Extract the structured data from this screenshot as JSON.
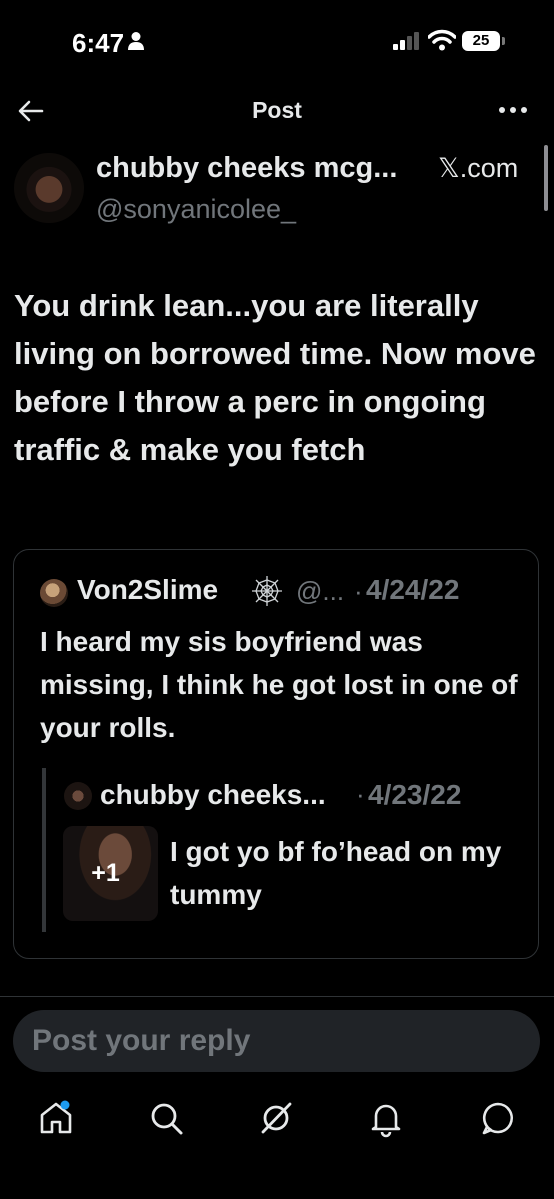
{
  "status_bar": {
    "time": "6:47",
    "battery": "25"
  },
  "nav": {
    "title": "Post"
  },
  "author": {
    "name": "chubby cheeks mcg...",
    "source": "𝕏.com",
    "handle": "@sonyanicolee_"
  },
  "post": {
    "text": "You drink lean...you are literally living on borrowed time. Now move before I throw a perc in ongoing traffic & make you fetch"
  },
  "quote": {
    "name": "Von2Slime",
    "handle": "@...",
    "separator": "·",
    "date": "4/24/22",
    "text": "I heard my sis boyfriend was missing, I think he got lost in one of your rolls.",
    "nested": {
      "name": "chubby cheeks...",
      "separator": "·",
      "date": "4/23/22",
      "media_count": "+1",
      "text": "I got yo bf fo’head on my tummy"
    }
  },
  "reply": {
    "placeholder": "Post your reply"
  },
  "tabs": [
    "home-icon",
    "search-icon",
    "grok-icon",
    "notifications-icon",
    "messages-icon"
  ],
  "colors": {
    "background": "#000000",
    "text": "#e7e9ea",
    "secondary": "#71767b",
    "border": "#2f3336",
    "accent": "#1d9bf0"
  }
}
